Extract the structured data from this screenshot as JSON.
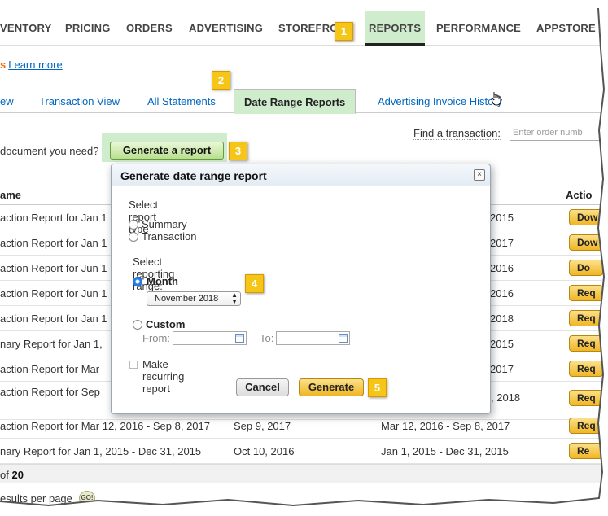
{
  "topnav": {
    "items": [
      "VENTORY",
      "PRICING",
      "ORDERS",
      "ADVERTISING",
      "STOREFRO",
      "REPORTS",
      "PERFORMANCE",
      "APPSTORE"
    ],
    "active": "REPORTS"
  },
  "callouts": [
    "1",
    "2",
    "3",
    "4",
    "5"
  ],
  "learn": {
    "bullet": "s",
    "link": "Learn more"
  },
  "subtabs": [
    "ew",
    "Transaction View",
    "All Statements",
    "Date Range Reports",
    "Advertising Invoice History"
  ],
  "question": "document you need?",
  "generate_report_button": "Generate a report",
  "find": {
    "label": "Find a transaction:",
    "placeholder": "Enter order numb"
  },
  "table": {
    "headers": {
      "name": "ame",
      "action": "Actio"
    },
    "rows": [
      {
        "name": "action Report for  Jan 1",
        "date": "",
        "range": "2015",
        "action": "Dow"
      },
      {
        "name": "action Report for  Jan 1",
        "date": "",
        "range": "2017",
        "action": "Dow"
      },
      {
        "name": "action Report for  Jun 1",
        "date": "",
        "range": "2016",
        "action": "Do"
      },
      {
        "name": "action Report for  Jun 1",
        "date": "",
        "range": "2016",
        "action": "Req"
      },
      {
        "name": "action Report for  Jan 1",
        "date": "",
        "range": "2018",
        "action": "Req"
      },
      {
        "name": "nary Report for  Jan 1,",
        "date": "",
        "range": "2015",
        "action": "Req"
      },
      {
        "name": "action Report for  Mar",
        "date": "",
        "range": "2017",
        "action": "Req"
      },
      {
        "name": "action Report for  Sep",
        "date": "",
        "range": ", 2018",
        "action": "Req"
      },
      {
        "name": "action Report for  Mar 12, 2016 - Sep 8, 2017",
        "date": "Sep 9, 2017",
        "range": "Mar 12, 2016 - Sep 8, 2017",
        "action": "Req"
      },
      {
        "name": "nary Report for  Jan 1, 2015 - Dec 31, 2015",
        "date": "Oct 10, 2016",
        "range": "Jan 1, 2015 - Dec 31, 2015",
        "action": "Re"
      }
    ],
    "pager_prefix": "of",
    "pager_total": "20",
    "results_per_page": "esults per page",
    "go": "GO!"
  },
  "modal": {
    "title": "Generate date range report",
    "close": "×",
    "report_type_label": "Select report type",
    "report_types": [
      "Summary",
      "Transaction"
    ],
    "range_label": "Select reporting range:",
    "month_label": "Month",
    "month_value": "November 2018",
    "custom_label": "Custom",
    "from_label": "From:",
    "to_label": "To:",
    "recurring_label": "Make recurring report",
    "cancel": "Cancel",
    "generate": "Generate"
  },
  "colors": {
    "active_tab": "#cfeccd",
    "callout": "#f5c518",
    "link": "#0066c0",
    "action_button": "#f0b625"
  }
}
